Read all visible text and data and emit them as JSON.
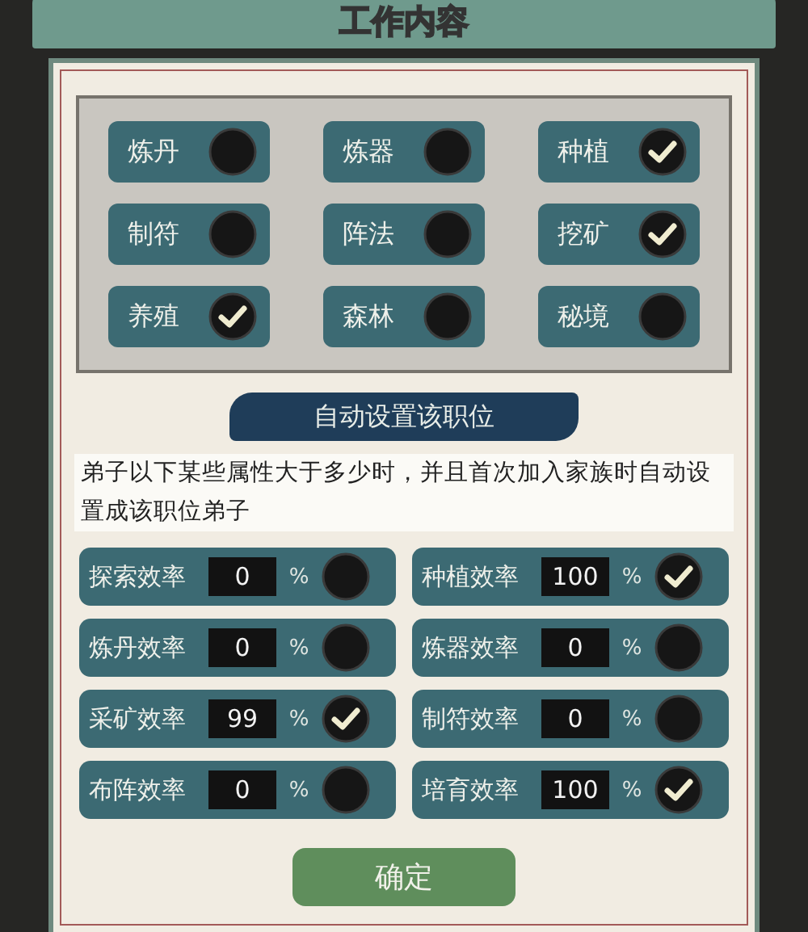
{
  "title": "工作内容",
  "jobs": [
    {
      "label": "炼丹",
      "checked": false
    },
    {
      "label": "炼器",
      "checked": false
    },
    {
      "label": "种植",
      "checked": true
    },
    {
      "label": "制符",
      "checked": false
    },
    {
      "label": "阵法",
      "checked": false
    },
    {
      "label": "挖矿",
      "checked": true
    },
    {
      "label": "养殖",
      "checked": true
    },
    {
      "label": "森林",
      "checked": false
    },
    {
      "label": "秘境",
      "checked": false
    }
  ],
  "auto_section": {
    "heading": "自动设置该职位",
    "description": "弟子以下某些属性大于多少时，并且首次加入家族时自动设置成该职位弟子"
  },
  "thresholds": [
    {
      "label": "探索效率",
      "value": "0",
      "unit": "%",
      "checked": false
    },
    {
      "label": "种植效率",
      "value": "100",
      "unit": "%",
      "checked": true
    },
    {
      "label": "炼丹效率",
      "value": "0",
      "unit": "%",
      "checked": false
    },
    {
      "label": "炼器效率",
      "value": "0",
      "unit": "%",
      "checked": false
    },
    {
      "label": "采矿效率",
      "value": "99",
      "unit": "%",
      "checked": true
    },
    {
      "label": "制符效率",
      "value": "0",
      "unit": "%",
      "checked": false
    },
    {
      "label": "布阵效率",
      "value": "0",
      "unit": "%",
      "checked": false
    },
    {
      "label": "培育效率",
      "value": "100",
      "unit": "%",
      "checked": true
    }
  ],
  "confirm_button": "确定"
}
